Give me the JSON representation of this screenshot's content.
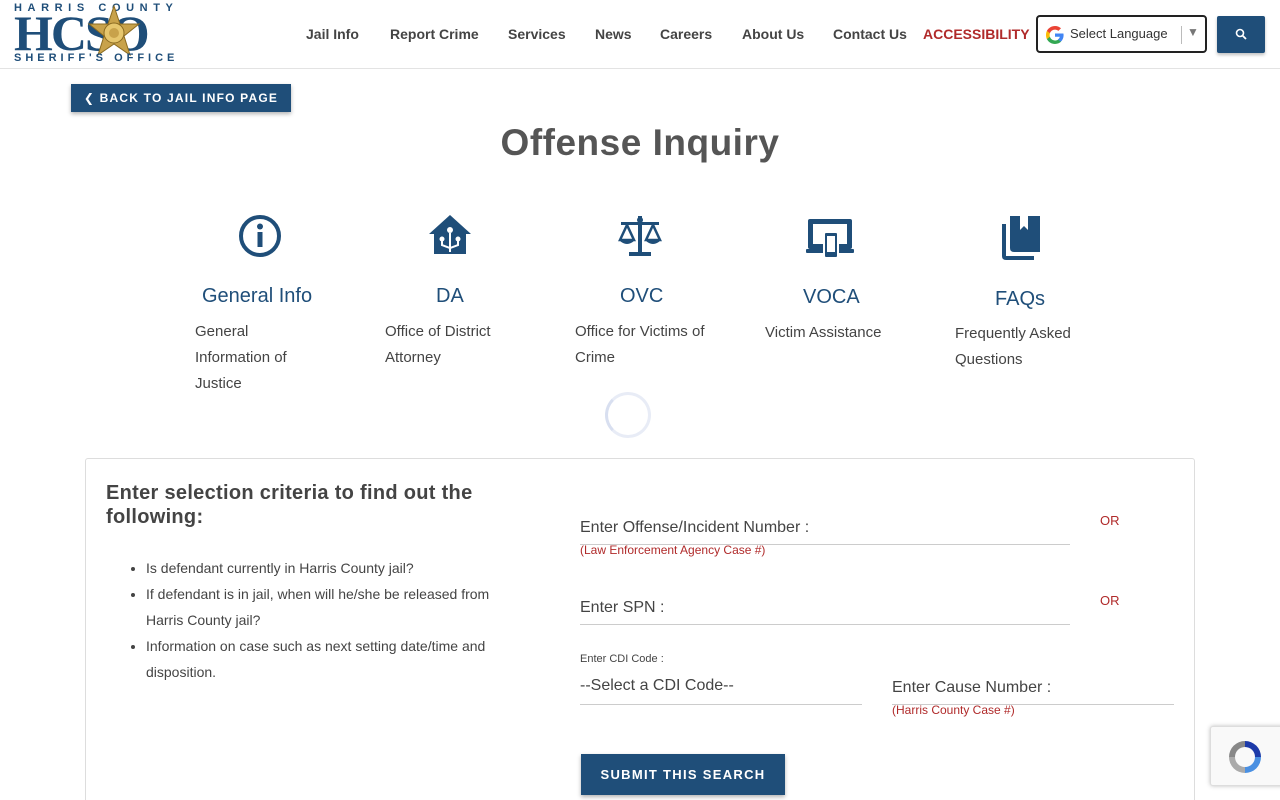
{
  "header": {
    "logo": {
      "top_text": "HARRIS COUNTY",
      "big_text": "HCSO",
      "bottom_text": "SHERIFF'S OFFICE"
    },
    "nav": [
      {
        "label": "Jail Info"
      },
      {
        "label": "Report Crime"
      },
      {
        "label": "Services"
      },
      {
        "label": "News"
      },
      {
        "label": "Careers"
      },
      {
        "label": "About Us"
      },
      {
        "label": "Contact Us"
      },
      {
        "label": "ACCESSIBILITY"
      }
    ],
    "language_select": {
      "label": "Select Language",
      "arrow": "▼"
    },
    "search_icon": "search-icon"
  },
  "back_button": {
    "label": "❮ BACK TO JAIL INFO PAGE"
  },
  "page_title": "Offense Inquiry",
  "cards": [
    {
      "title": "General Info",
      "desc": "General Information of Justice",
      "icon": "info-circle-icon"
    },
    {
      "title": "DA",
      "desc": "Office of District Attorney",
      "icon": "house-network-icon"
    },
    {
      "title": "OVC",
      "desc": "Office for Victims of Crime",
      "icon": "scales-icon"
    },
    {
      "title": "VOCA",
      "desc": "Victim Assistance",
      "icon": "devices-icon"
    },
    {
      "title": "FAQs",
      "desc": "Frequently Asked Questions",
      "icon": "books-icon"
    }
  ],
  "form": {
    "heading": "Enter selection criteria to find out the following:",
    "bullets": [
      "Is defendant currently in Harris County jail?",
      "If defendant is in jail, when will he/she be released from Harris County jail?",
      "Information on case such as next setting date/time and disposition."
    ],
    "offense_label": "Enter Offense/Incident Number :",
    "offense_hint": "(Law Enforcement Agency Case #)",
    "or_1": "OR",
    "spn_label": "Enter SPN :",
    "or_2": "OR",
    "cdi_label": "Enter CDI Code :",
    "cdi_placeholder": "--Select a CDI Code--",
    "cause_label": "Enter Cause Number :",
    "cause_hint": "(Harris County Case #)",
    "submit_label": "SUBMIT THIS SEARCH"
  },
  "colors": {
    "brand": "#1f4e79",
    "accent_red": "#b02a2a"
  }
}
